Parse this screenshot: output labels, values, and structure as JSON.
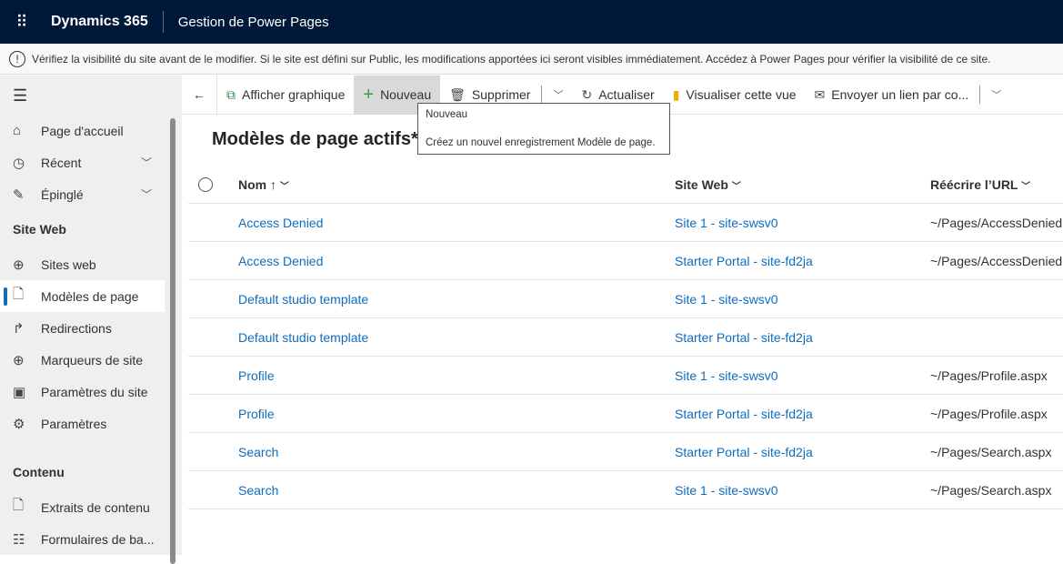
{
  "topbar": {
    "brand": "Dynamics 365",
    "app": "Gestion de Power Pages"
  },
  "notice": "Vérifiez la visibilité du site avant de le modifier. Si le site est défini sur Public, les modifications apportées ici seront visibles immédiatement. Accédez à Power Pages pour vérifier la visibilité de ce site.",
  "sidebar": {
    "nav": [
      {
        "label": "Page d'accueil",
        "icon": "home-icon"
      },
      {
        "label": "Récent",
        "icon": "clock-icon"
      },
      {
        "label": "Épinglé",
        "icon": "pin-icon"
      }
    ],
    "section1": "Site Web",
    "site_items": [
      {
        "label": "Sites web",
        "icon": "globe-icon"
      },
      {
        "label": "Modèles de page",
        "icon": "page-icon",
        "selected": true
      },
      {
        "label": "Redirections",
        "icon": "redirect-icon"
      },
      {
        "label": "Marqueurs de site",
        "icon": "globe-star-icon"
      },
      {
        "label": "Paramètres du site",
        "icon": "site-settings-icon"
      },
      {
        "label": "Paramètres",
        "icon": "gear-icon"
      }
    ],
    "section2": "Contenu",
    "content_items": [
      {
        "label": "Extraits de contenu",
        "icon": "code-file-icon"
      },
      {
        "label": "Formulaires de ba...",
        "icon": "form-icon"
      }
    ]
  },
  "toolbar": {
    "chart": "Afficher graphique",
    "new": "Nouveau",
    "delete": "Supprimer",
    "refresh": "Actualiser",
    "visualize": "Visualiser cette vue",
    "email": "Envoyer un lien par co..."
  },
  "tooltip": {
    "title": "Nouveau",
    "desc": "Créez un nouvel enregistrement Modèle de page."
  },
  "view_title": "Modèles de page actifs*",
  "columns": {
    "name": "Nom ↑",
    "site": "Site Web",
    "url": "Réécrire l’URL"
  },
  "rows": [
    {
      "name": "Access Denied",
      "site": "Site 1 - site-swsv0",
      "url": "~/Pages/AccessDenied."
    },
    {
      "name": "Access Denied",
      "site": "Starter Portal - site-fd2ja",
      "url": "~/Pages/AccessDenied."
    },
    {
      "name": "Default studio template",
      "site": "Site 1 - site-swsv0",
      "url": ""
    },
    {
      "name": "Default studio template",
      "site": "Starter Portal - site-fd2ja",
      "url": ""
    },
    {
      "name": "Profile",
      "site": "Site 1 - site-swsv0",
      "url": "~/Pages/Profile.aspx"
    },
    {
      "name": "Profile",
      "site": "Starter Portal - site-fd2ja",
      "url": "~/Pages/Profile.aspx"
    },
    {
      "name": "Search",
      "site": "Starter Portal - site-fd2ja",
      "url": "~/Pages/Search.aspx"
    },
    {
      "name": "Search",
      "site": "Site 1 - site-swsv0",
      "url": "~/Pages/Search.aspx"
    }
  ],
  "colors": {
    "topbar": "#00183a",
    "link": "#0f6cbd"
  }
}
